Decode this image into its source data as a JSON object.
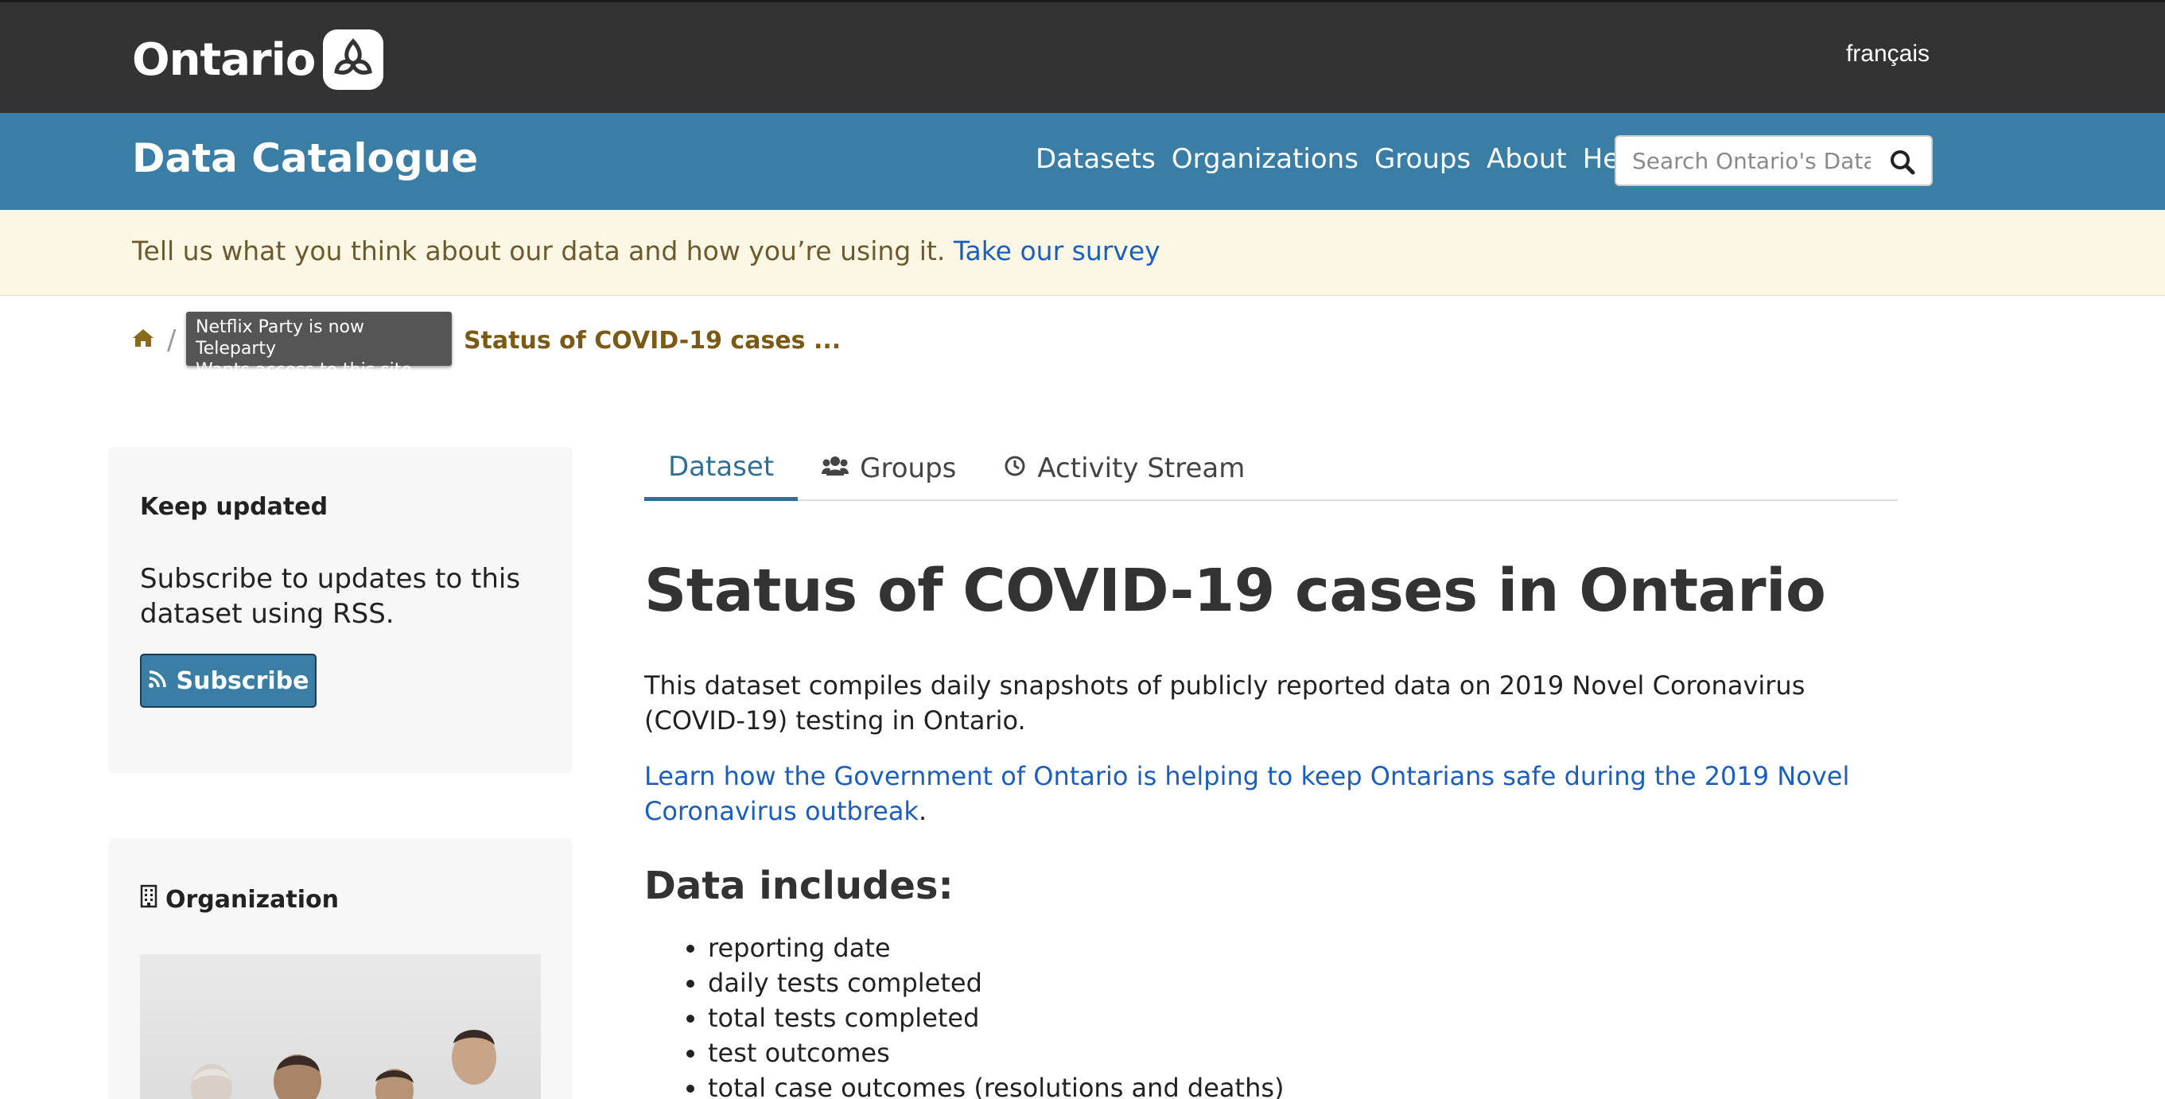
{
  "header": {
    "logo_text": "Ontario",
    "language_link": "français"
  },
  "catalogue": {
    "title": "Data Catalogue",
    "nav": [
      "Datasets",
      "Organizations",
      "Groups",
      "About",
      "Help"
    ],
    "search_placeholder": "Search Ontario's Data"
  },
  "survey": {
    "text": "Tell us what you think about our data and how you’re using it. ",
    "link": "Take our survey"
  },
  "breadcrumb": {
    "partial_item": "h",
    "current": "Status of COVID-19 cases ..."
  },
  "tooltip": {
    "line1": "Netflix Party is now Teleparty",
    "line2": "Wants access to this site"
  },
  "sidebar": {
    "keep_updated": {
      "title": "Keep updated",
      "text": "Subscribe to updates to this dataset using RSS.",
      "button": "Subscribe"
    },
    "organization": {
      "title": "Organization"
    }
  },
  "tabs": [
    {
      "label": "Dataset",
      "icon": "none"
    },
    {
      "label": "Groups",
      "icon": "users-icon"
    },
    {
      "label": "Activity Stream",
      "icon": "clock-icon"
    }
  ],
  "main": {
    "title": "Status of COVID-19 cases in Ontario",
    "description": "This dataset compiles daily snapshots of publicly reported data on 2019 Novel Coronavirus (COVID-19) testing in Ontario.",
    "learn_link": "Learn how the Government of Ontario is helping to keep Ontarians safe during the 2019 Novel Coronavirus outbreak",
    "learn_period": ".",
    "data_heading": "Data includes:",
    "data_items": [
      "reporting date",
      "daily tests completed",
      "total tests completed",
      "test outcomes",
      "total case outcomes (resolutions and deaths)"
    ]
  },
  "colors": {
    "topbar": "#333333",
    "catalogue_bar": "#3a7ea5",
    "survey_bg": "#fbf7e4",
    "link": "#1a5fbf",
    "tab_active": "#2f6f96"
  }
}
